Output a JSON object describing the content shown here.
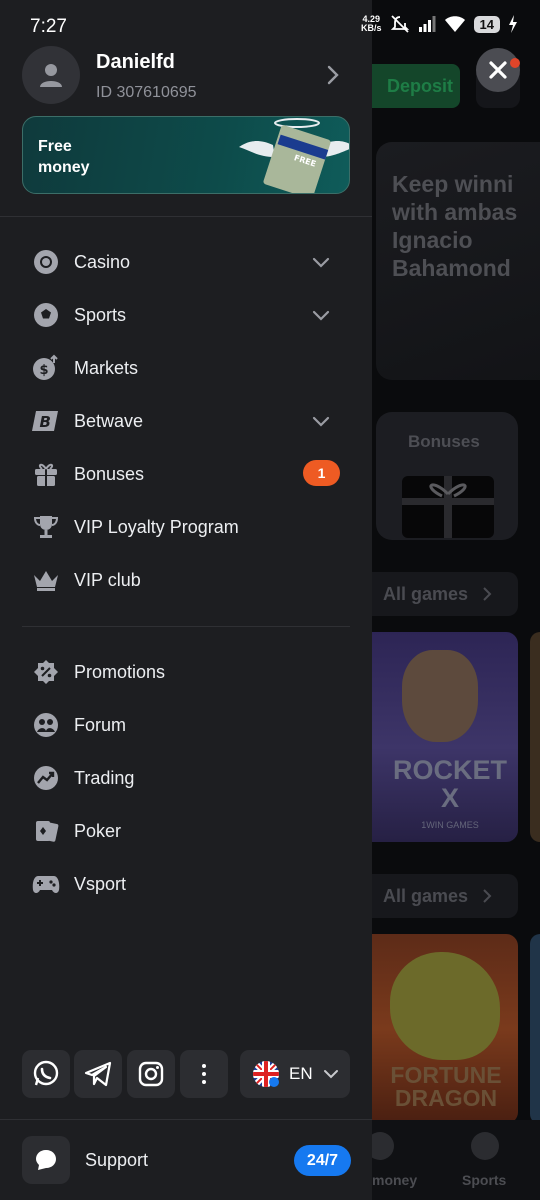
{
  "status_bar": {
    "time": "7:27",
    "net_speed_value": "4.29",
    "net_speed_unit": "KB/s",
    "battery": "14",
    "icons": [
      "mute-icon",
      "signal-icon",
      "wifi-icon",
      "battery-icon",
      "charging-icon"
    ]
  },
  "profile": {
    "name": "Danielfd",
    "id_text": "ID 307610695"
  },
  "banner": {
    "line1": "Free",
    "line2": "money",
    "art_label": "FREE"
  },
  "menu": {
    "primary": [
      {
        "label": "Casino",
        "icon": "casino-chip-icon",
        "has_chevron": true
      },
      {
        "label": "Sports",
        "icon": "soccer-ball-icon",
        "has_chevron": true
      },
      {
        "label": "Markets",
        "icon": "dollar-up-icon",
        "has_chevron": false
      },
      {
        "label": "Betwave",
        "icon": "betwave-b-icon",
        "has_chevron": true
      },
      {
        "label": "Bonuses",
        "icon": "gift-icon",
        "badge": "1"
      },
      {
        "label": "VIP Loyalty Program",
        "icon": "trophy-icon"
      },
      {
        "label": "VIP club",
        "icon": "crown-icon"
      }
    ],
    "secondary": [
      {
        "label": "Promotions",
        "icon": "percent-badge-icon"
      },
      {
        "label": "Forum",
        "icon": "forum-icon"
      },
      {
        "label": "Trading",
        "icon": "trading-chart-icon"
      },
      {
        "label": "Poker",
        "icon": "poker-cards-icon"
      },
      {
        "label": "Vsport",
        "icon": "gamepad-icon"
      }
    ]
  },
  "social": {
    "icons": [
      "whatsapp-icon",
      "telegram-icon",
      "instagram-icon",
      "more-icon"
    ]
  },
  "language": {
    "code": "EN",
    "flag": "uk-flag-icon"
  },
  "support": {
    "label": "Support",
    "badge": "24/7"
  },
  "background": {
    "deposit_label": "Deposit",
    "promo_text": "Keep winning with ambassador Ignacio Bahamonde",
    "promo_lines": [
      "Keep winni",
      "with ambas",
      "Ignacio",
      "Bahamond"
    ],
    "bonuses_title": "Bonuses",
    "all_games_1": "All games",
    "all_games_2": "All games",
    "game1_title_1": "ROCKET",
    "game1_title_2": "X",
    "game1_sub": "1WIN GAMES",
    "game2_title_1": "FORTUNE",
    "game2_title_2": "DRAGON",
    "nav_money": "money",
    "nav_sports": "Sports"
  },
  "colors": {
    "drawer_bg": "#1d1e21",
    "accent_orange": "#ee5b23",
    "accent_blue": "#1679f0",
    "deposit_green": "#14462a"
  }
}
